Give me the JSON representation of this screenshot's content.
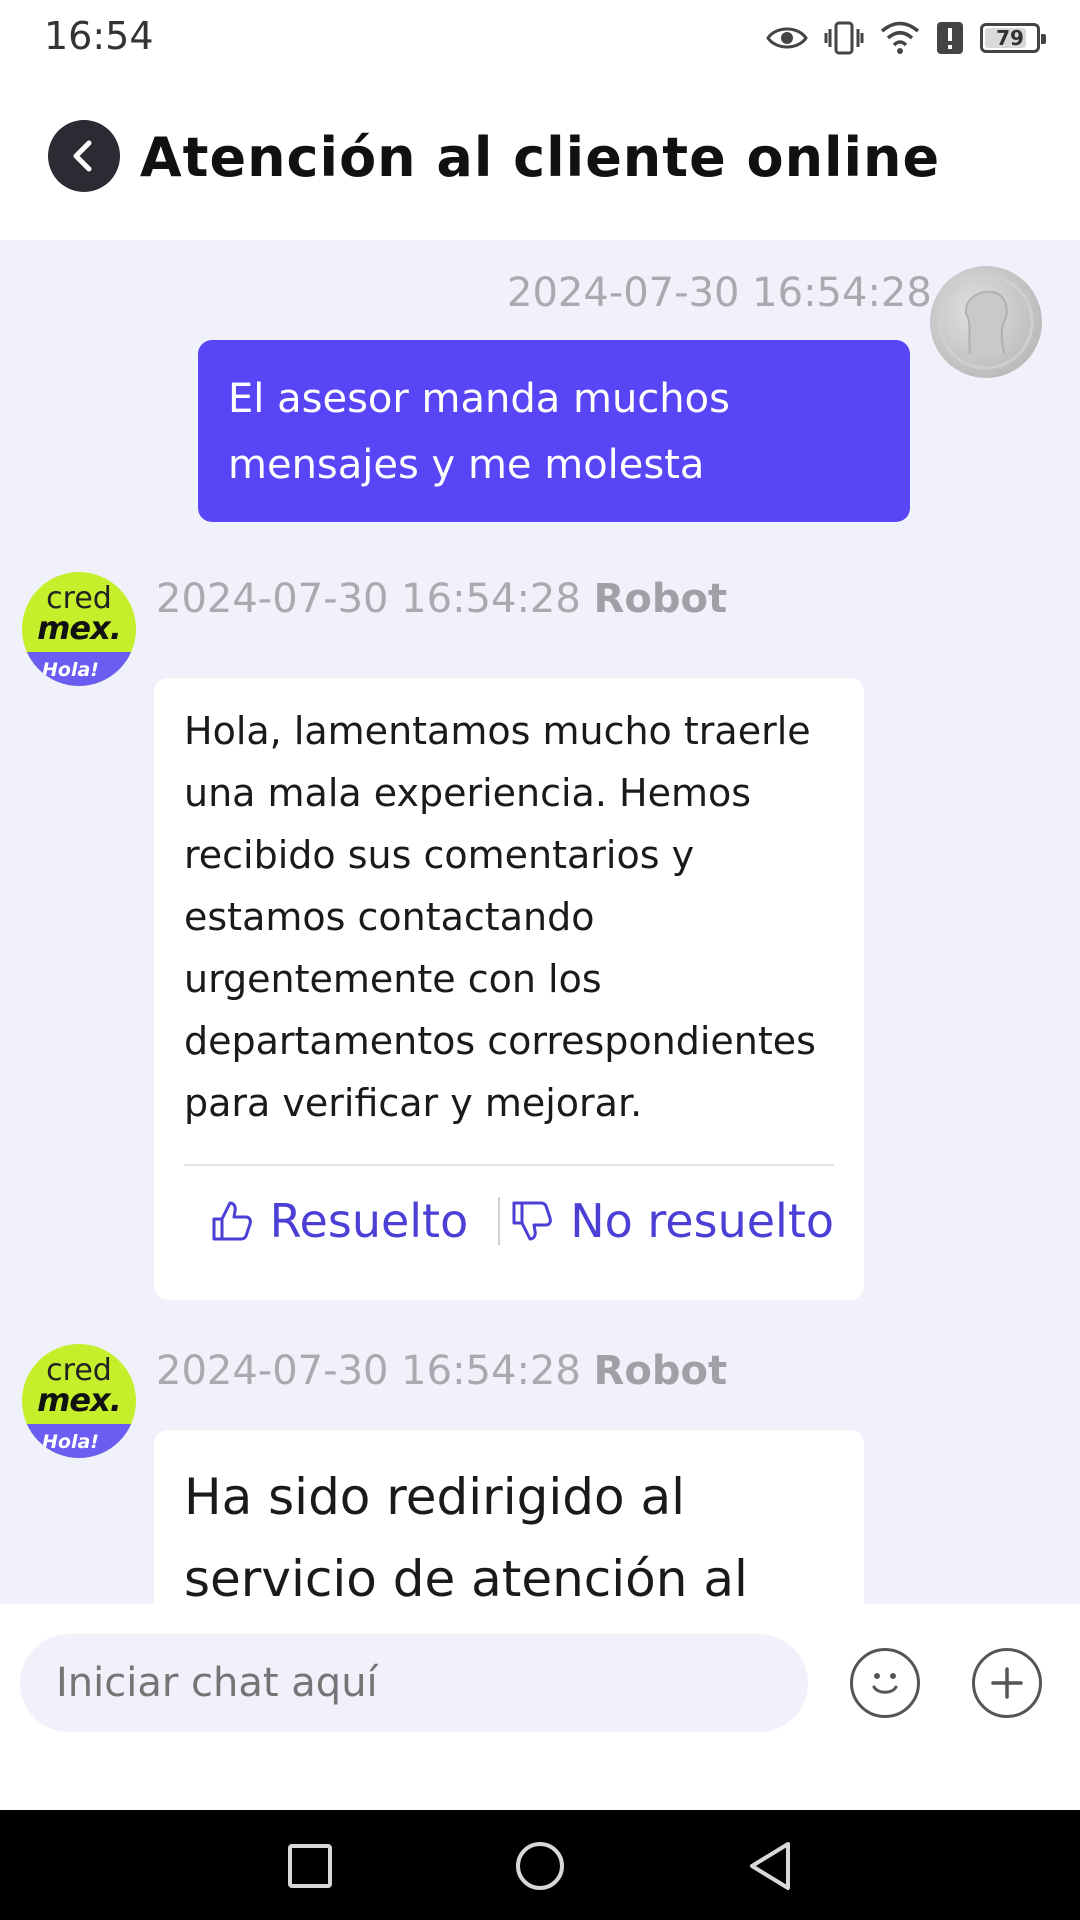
{
  "status_bar": {
    "time": "16:54",
    "battery": "79",
    "battery_level_percent": 79
  },
  "header": {
    "title": "Atención al cliente online",
    "back_icon": "chevron-left-icon"
  },
  "messages": [
    {
      "from": "user",
      "timestamp": "2024-07-30 16:54:28",
      "text": "El asesor manda muchos mensajes y me molesta"
    },
    {
      "from": "bot",
      "timestamp": "2024-07-30 16:54:28",
      "sender": "Robot",
      "avatar": {
        "line1": "cred",
        "line2": "mex.",
        "badge": "Hola!"
      },
      "text": "Hola, lamentamos mucho traerle una mala experiencia. Hemos recibido sus comentarios y estamos contactando urgentemente con los departamentos correspondientes para verificar y mejorar.",
      "feedback": {
        "resolved": "Resuelto",
        "not_resolved": "No resuelto"
      }
    },
    {
      "from": "bot",
      "timestamp": "2024-07-30 16:54:28",
      "sender": "Robot",
      "avatar": {
        "line1": "cred",
        "line2": "mex.",
        "badge": "Hola!"
      },
      "text": "Ha sido redirigido al servicio de atención al"
    }
  ],
  "composer": {
    "placeholder": "Iniciar chat aquí",
    "emoji_icon": "smiley-icon",
    "add_icon": "plus-icon"
  },
  "colors": {
    "user_bubble": "#5845f5",
    "chat_bg": "#f0f1fb",
    "bot_avatar": "#c6ef2b",
    "accent": "#4b3fd6"
  }
}
